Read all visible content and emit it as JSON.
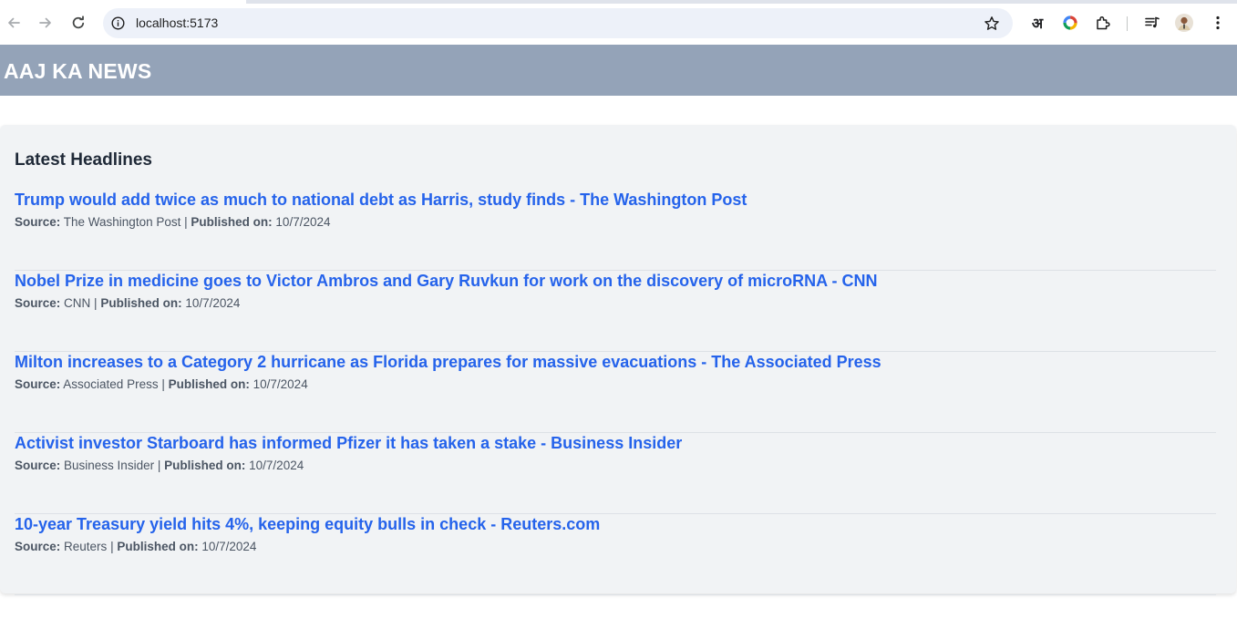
{
  "browser": {
    "url": "localhost:5173",
    "extension_hindi_glyph": "अ"
  },
  "header": {
    "title": "AAJ KA NEWS"
  },
  "headlines": {
    "section_title": "Latest Headlines",
    "source_label": "Source:",
    "published_label": "Published on:",
    "separator": "|",
    "items": [
      {
        "title": "Trump would add twice as much to national debt as Harris, study finds - The Washington Post",
        "source": "The Washington Post",
        "date": "10/7/2024"
      },
      {
        "title": "Nobel Prize in medicine goes to Victor Ambros and Gary Ruvkun for work on the discovery of microRNA - CNN",
        "source": "CNN",
        "date": "10/7/2024"
      },
      {
        "title": "Milton increases to a Category 2 hurricane as Florida prepares for massive evacuations - The Associated Press",
        "source": "Associated Press",
        "date": "10/7/2024"
      },
      {
        "title": "Activist investor Starboard has informed Pfizer it has taken a stake - Business Insider",
        "source": "Business Insider",
        "date": "10/7/2024"
      },
      {
        "title": "10-year Treasury yield hits 4%, keeping equity bulls in check - Reuters.com",
        "source": "Reuters",
        "date": "10/7/2024"
      }
    ]
  },
  "colors": {
    "header_bg": "#94a3b8",
    "link": "#2563eb",
    "card_bg": "#f1f3f5"
  }
}
